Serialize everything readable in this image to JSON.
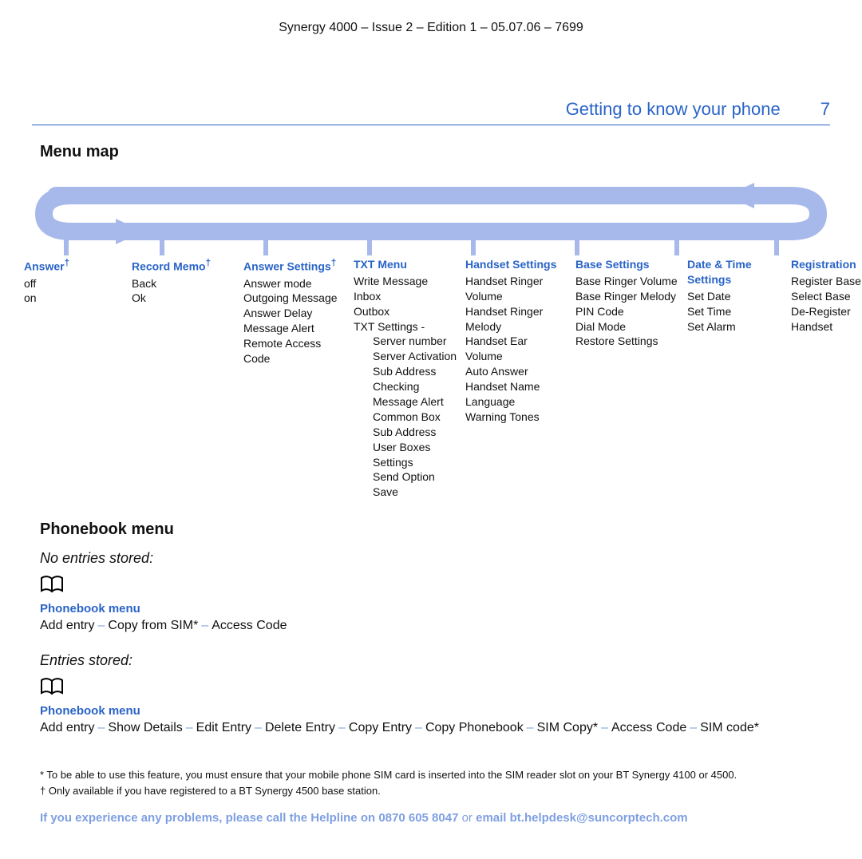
{
  "doc_id": "Synergy 4000 – Issue 2 – Edition 1 – 05.07.06 – 7699",
  "section_title": "Getting to know your phone",
  "page_number": "7",
  "menu_map_title": "Menu map",
  "columns": {
    "answer": {
      "head": "Answer",
      "dagger": "†",
      "items": [
        "off",
        "on"
      ]
    },
    "record_memo": {
      "head": "Record Memo",
      "dagger": "†",
      "items": [
        "Back",
        "Ok"
      ]
    },
    "answer_settings": {
      "head": "Answer Settings",
      "dagger": "†",
      "items": [
        "Answer mode",
        "Outgoing Message",
        "Answer Delay",
        "Message Alert",
        "Remote Access Code"
      ]
    },
    "txt_menu": {
      "head": "TXT Menu",
      "items": [
        "Write Message",
        "Inbox",
        "Outbox",
        "TXT Settings -"
      ],
      "sub": [
        "Server number",
        "Server Activation",
        "Sub Address Checking",
        "Message Alert",
        "Common Box Sub Address",
        "User Boxes Settings",
        "Send Option Save"
      ]
    },
    "handset": {
      "head": "Handset Settings",
      "items": [
        "Handset Ringer Volume",
        "Handset Ringer Melody",
        "Handset Ear Volume",
        "Auto Answer",
        "Handset Name",
        "Language",
        "Warning Tones"
      ]
    },
    "base": {
      "head": "Base Settings",
      "items": [
        "Base Ringer Volume",
        "Base Ringer Melody",
        "PIN Code",
        "Dial Mode",
        "Restore Settings"
      ]
    },
    "datetime": {
      "head": "Date & Time Settings",
      "items": [
        "Set Date",
        "Set Time",
        "Set Alarm"
      ]
    },
    "registration": {
      "head": "Registration",
      "items": [
        "Register Base",
        "Select Base",
        "De-Register Handset"
      ]
    }
  },
  "phonebook": {
    "title": "Phonebook menu",
    "state_none": "No entries stored:",
    "state_some": "Entries stored:",
    "menu_label": "Phonebook menu",
    "none_items": [
      "Add entry",
      "Copy from SIM*",
      "Access Code"
    ],
    "some_items": [
      "Add entry",
      "Show Details",
      "Edit Entry",
      "Delete Entry",
      "Copy Entry",
      "Copy Phonebook",
      "SIM Copy*",
      "Access Code",
      "SIM code*"
    ]
  },
  "footnotes": {
    "star": "* To be able to use this feature, you must ensure that your mobile phone SIM card is inserted into the SIM reader slot on your BT Synergy 4100 or 4500.",
    "dagger": "† Only available if you have registered to a BT Synergy 4500 base station."
  },
  "helpline": {
    "pre": "If you experience any problems, please call the Helpline on ",
    "phone": "0870 605 8047",
    "mid": " or ",
    "email_word": "email ",
    "email": "bt.helpdesk@suncorptech.com"
  }
}
